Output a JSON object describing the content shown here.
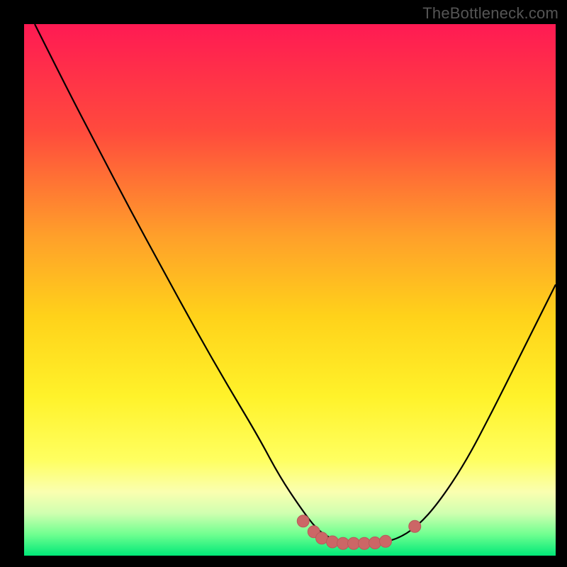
{
  "watermark": "TheBottleneck.com",
  "colors": {
    "frame": "#000000",
    "curve": "#000000",
    "marker_fill": "#cc6666",
    "marker_stroke": "#b85a5a"
  },
  "chart_data": {
    "type": "line",
    "title": "",
    "xlabel": "",
    "ylabel": "",
    "xlim": [
      0,
      100
    ],
    "ylim": [
      0,
      100
    ],
    "grid": false,
    "background_gradient": {
      "stops": [
        {
          "offset": 0.0,
          "color": "#ff1a53"
        },
        {
          "offset": 0.2,
          "color": "#ff4a3d"
        },
        {
          "offset": 0.4,
          "color": "#ffa02a"
        },
        {
          "offset": 0.55,
          "color": "#ffd21a"
        },
        {
          "offset": 0.7,
          "color": "#fff22a"
        },
        {
          "offset": 0.82,
          "color": "#ffff60"
        },
        {
          "offset": 0.88,
          "color": "#faffb0"
        },
        {
          "offset": 0.92,
          "color": "#d0ffb0"
        },
        {
          "offset": 0.96,
          "color": "#70ff90"
        },
        {
          "offset": 1.0,
          "color": "#00e878"
        }
      ]
    },
    "series": [
      {
        "name": "bottleneck-curve",
        "x": [
          2.0,
          8.0,
          14.0,
          20.0,
          26.0,
          32.0,
          38.0,
          44.0,
          48.0,
          52.0,
          55.0,
          58.0,
          62.0,
          66.0,
          70.0,
          74.0,
          78.0,
          83.0,
          88.0,
          93.0,
          98.0,
          100.0
        ],
        "y": [
          100.0,
          88.0,
          76.5,
          65.0,
          54.0,
          43.0,
          32.5,
          22.5,
          15.0,
          9.0,
          5.0,
          3.0,
          2.3,
          2.3,
          3.0,
          5.5,
          10.0,
          17.5,
          27.0,
          37.0,
          47.0,
          51.0
        ]
      }
    ],
    "markers": [
      {
        "x": 52.5,
        "y": 6.5
      },
      {
        "x": 54.5,
        "y": 4.5
      },
      {
        "x": 56.0,
        "y": 3.3
      },
      {
        "x": 58.0,
        "y": 2.6
      },
      {
        "x": 60.0,
        "y": 2.3
      },
      {
        "x": 62.0,
        "y": 2.3
      },
      {
        "x": 64.0,
        "y": 2.3
      },
      {
        "x": 66.0,
        "y": 2.4
      },
      {
        "x": 68.0,
        "y": 2.7
      },
      {
        "x": 73.5,
        "y": 5.5
      }
    ]
  }
}
